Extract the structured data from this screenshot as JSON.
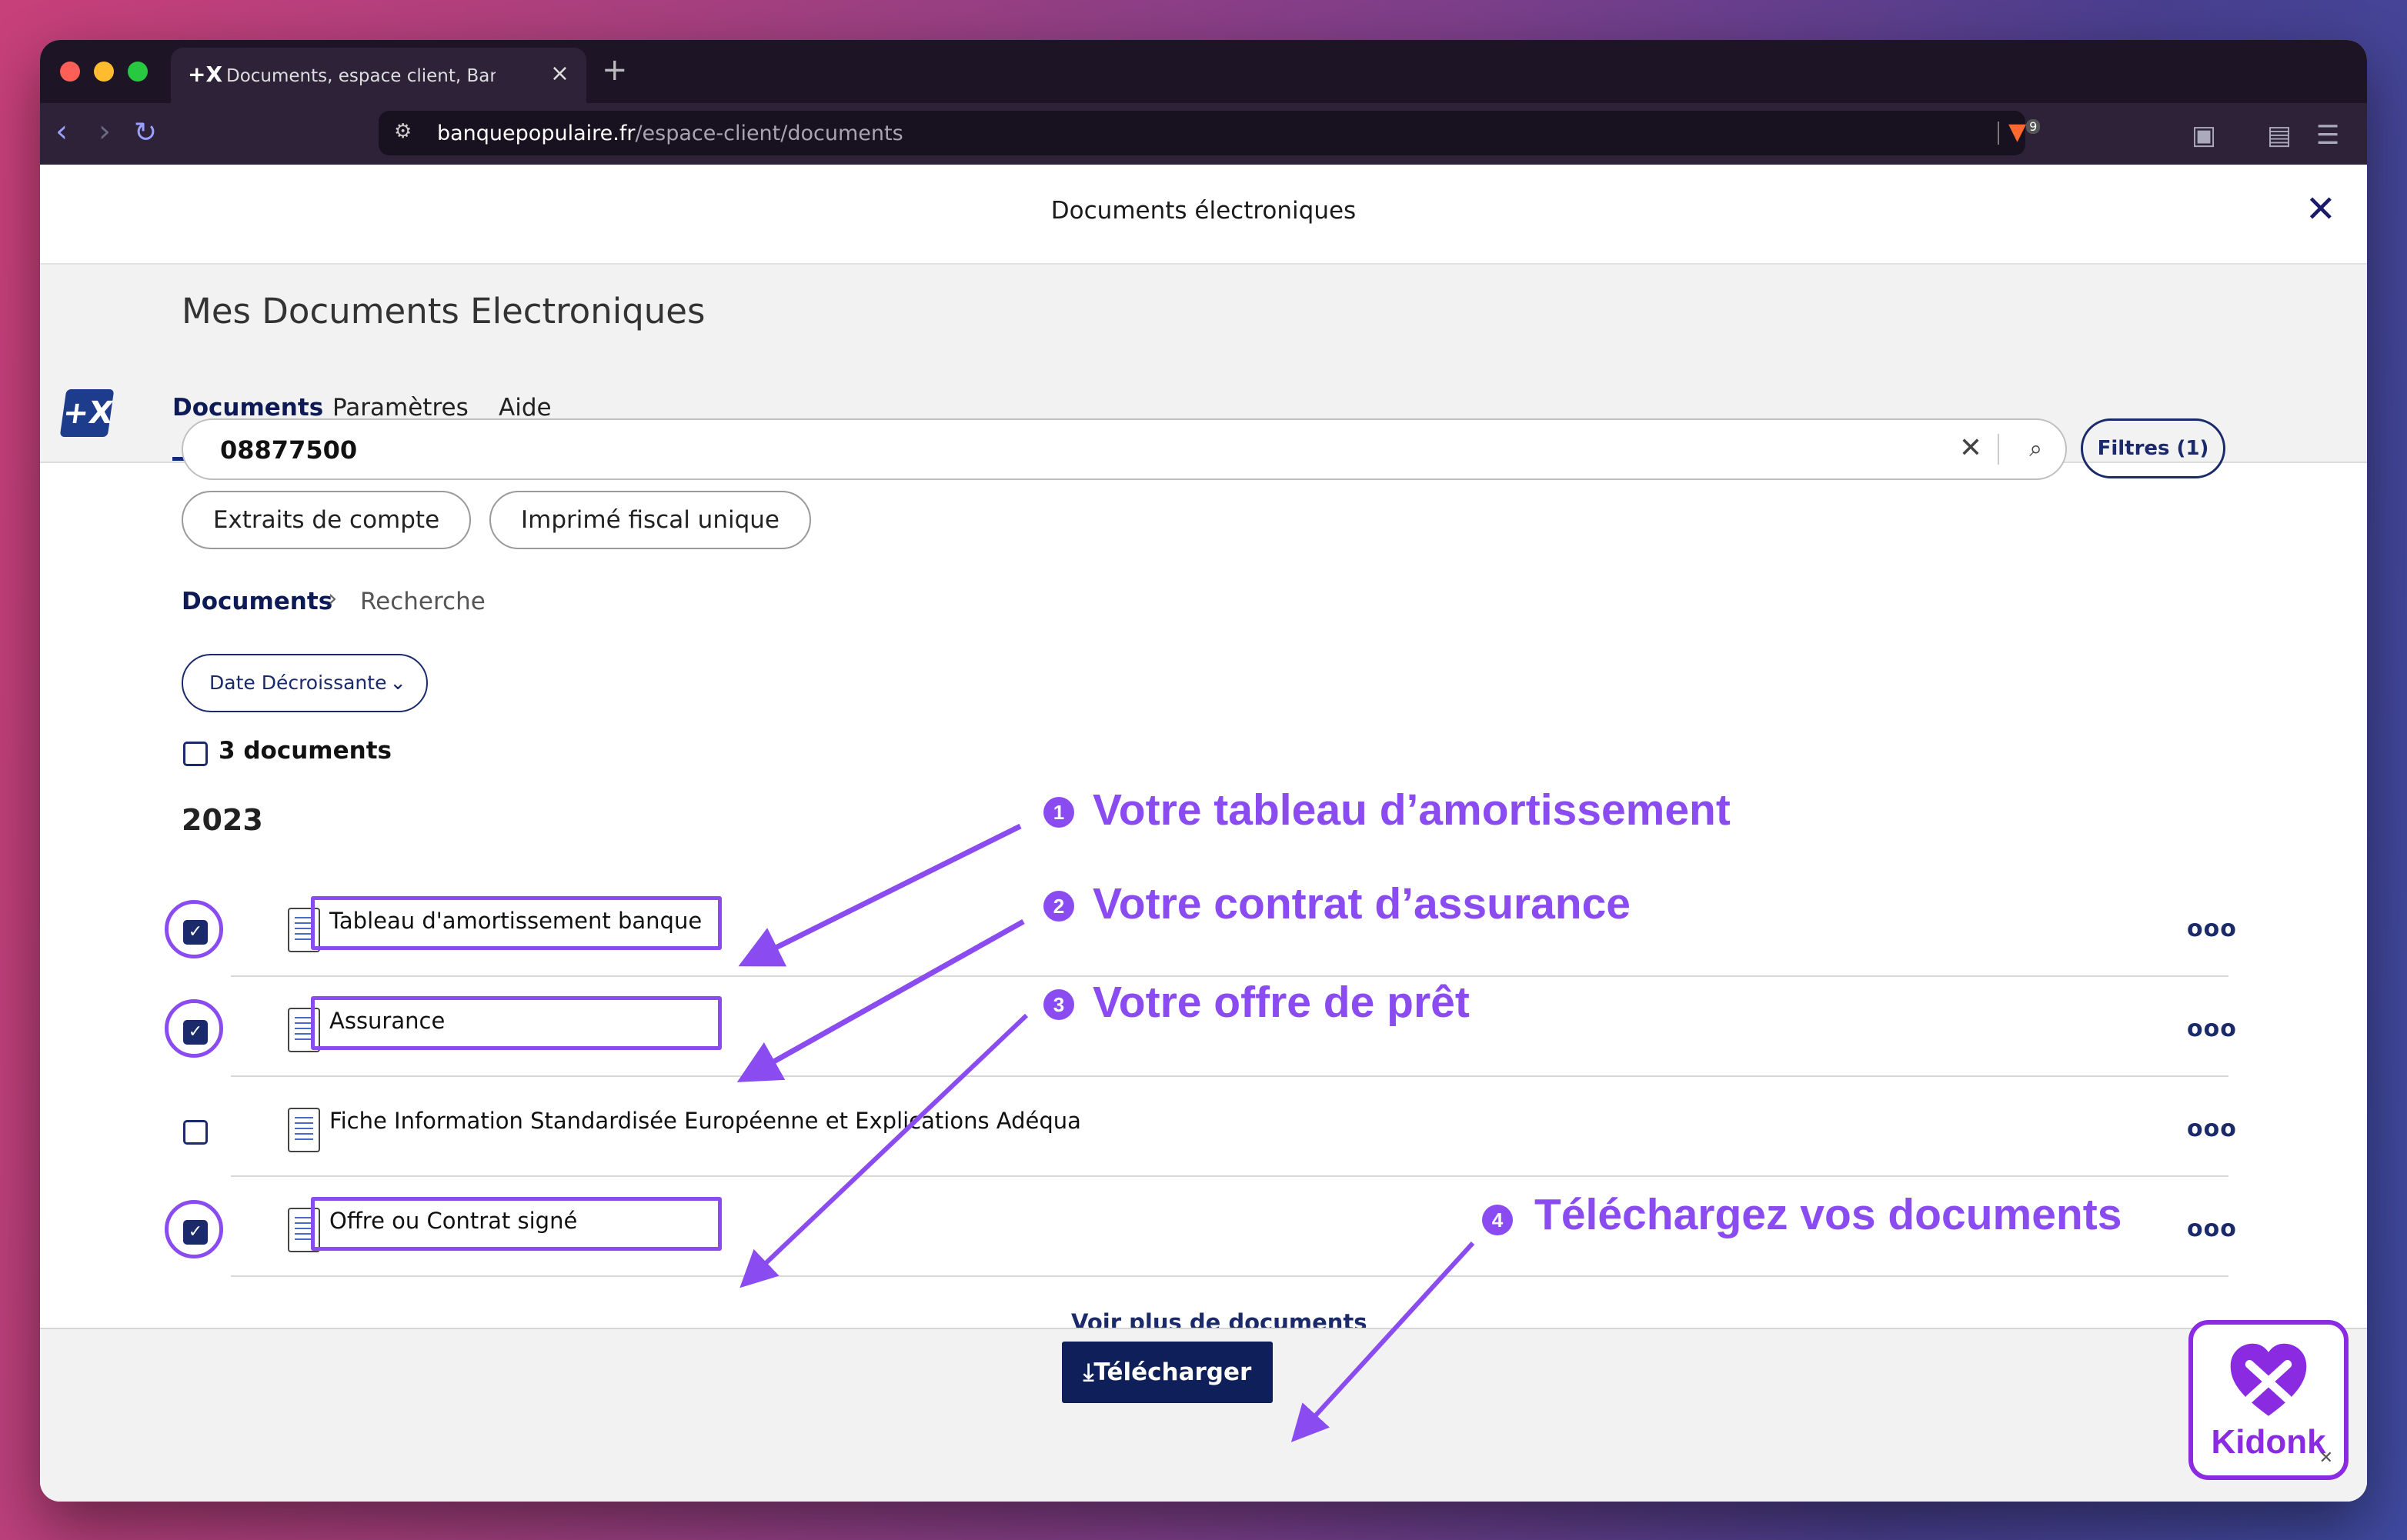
{
  "browser": {
    "tab_logo": "+X",
    "tab_title": "Documents, espace client, Banque Populaire",
    "tab_close": "×",
    "new_tab": "+",
    "url_domain": "banquepopulaire.fr",
    "url_path": "/espace-client/documents",
    "brave_badge": "9"
  },
  "modal": {
    "title": "Documents électroniques",
    "close": "✕"
  },
  "header": {
    "heading": "Mes Documents Electroniques",
    "logo": "+X",
    "tabs": [
      "Documents",
      "Paramètres",
      "Aide"
    ]
  },
  "search": {
    "value": "08877500",
    "clear": "✕",
    "filters_label": "Filtres (1)"
  },
  "chips": [
    "Extraits de compte",
    "Imprimé fiscal unique"
  ],
  "breadcrumb": {
    "root": "Documents",
    "separator": "›",
    "current": "Recherche"
  },
  "sort": {
    "label": "Date Décroissante"
  },
  "count_label": "3 documents",
  "year": "2023",
  "documents": [
    {
      "title": "Tableau d'amortissement banque",
      "checked": true
    },
    {
      "title": "Assurance",
      "checked": true
    },
    {
      "title": "Fiche Information Standardisée Européenne et Explications Adéqua",
      "checked": false
    },
    {
      "title": "Offre ou Contrat signé",
      "checked": true
    }
  ],
  "more_icon": "ooo",
  "voir_plus": "Voir plus de documents",
  "download_label": "⤓Télécharger",
  "annotations": [
    {
      "num": "1",
      "text": "Votre tableau d’amortissement"
    },
    {
      "num": "2",
      "text": "Votre contrat d’assurance"
    },
    {
      "num": "3",
      "text": "Votre offre de prêt"
    },
    {
      "num": "4",
      "text": "Téléchargez vos documents"
    }
  ],
  "widget": {
    "name": "Kidonk",
    "close": "✕"
  },
  "colors": {
    "accent": "#8a4bf0",
    "brand_navy": "#0e1f5a",
    "widget": "#8a2be2"
  }
}
